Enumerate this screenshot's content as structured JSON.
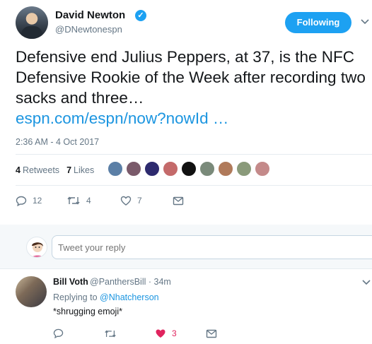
{
  "tweet": {
    "author_name": "David Newton",
    "author_handle": "@DNewtonespn",
    "follow_label": "Following",
    "text": "Defensive end Julius Peppers, at 37, is the NFC Defensive Rookie of the Week after recording two sacks and three…",
    "link": "espn.com/espn/now?nowId …",
    "timestamp": "2:36 AM - 4 Oct 2017",
    "retweets_count": "4",
    "retweets_label": "Retweets",
    "likes_count": "7",
    "likes_label": "Likes",
    "replies": "12",
    "retweets": "4",
    "likes": "7"
  },
  "reply_box": {
    "placeholder": "Tweet your reply"
  },
  "reply": {
    "name": "Bill Voth",
    "handle_time": "@PanthersBill · 34m",
    "replying_prefix": "Replying to",
    "mention": "@Nhatcherson",
    "text": "*shrugging emoji*",
    "likes": "3"
  },
  "colors": {
    "accent": "#1da1f2",
    "link": "#1b95e0",
    "like_red": "#e0245e",
    "muted": "#657786"
  },
  "icons": [
    "verified-icon",
    "chevron-down-icon",
    "reply-icon",
    "retweet-icon",
    "like-icon",
    "dm-icon"
  ]
}
